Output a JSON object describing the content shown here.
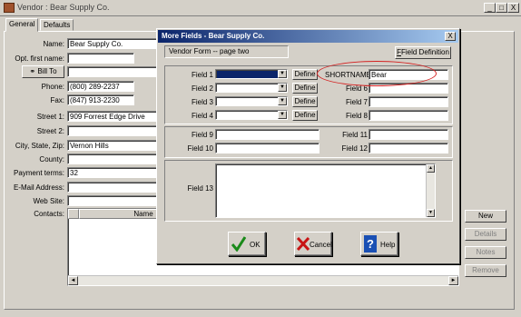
{
  "window": {
    "title": "Vendor : Bear Supply Co.",
    "controls": [
      "_",
      "□",
      "X"
    ]
  },
  "tabs": [
    {
      "label": "General"
    },
    {
      "label": "Defaults"
    }
  ],
  "form": {
    "name_label": "Name:",
    "name_value": "Bear Supply Co.",
    "opt_first_label": "Opt. first name:",
    "opt_first_value": "",
    "bill_to_label": "Bill To",
    "bill_to_value": "",
    "phone_label": "Phone:",
    "phone_value": "(800) 289-2237",
    "fax_label": "Fax:",
    "fax_value": "(847) 913-2230",
    "street1_label": "Street 1:",
    "street1_value": "909 Forrest Edge Drive",
    "street2_label": "Street 2:",
    "street2_value": "",
    "city_label": "City, State, Zip:",
    "city_value": "Vernon Hills",
    "county_label": "County:",
    "county_value": "",
    "payment_label": "Payment terms:",
    "payment_value": "32",
    "email_label": "E-Mail Address:",
    "email_value": "",
    "website_label": "Web Site:",
    "website_value": "",
    "contacts_label": "Contacts:",
    "contacts_column": "Name"
  },
  "side_buttons": {
    "new": "New",
    "details": "Details",
    "notes": "Notes",
    "remove": "Remove"
  },
  "dialog": {
    "title": "More Fields - Bear Supply Co.",
    "close": "X",
    "page_caption": "Vendor Form -- page two",
    "field_definition": "Field Definition",
    "define": "Define",
    "fields": {
      "f1": "Field 1",
      "f2": "Field 2",
      "f3": "Field 3",
      "f4": "Field 4",
      "f6": "Field 6",
      "f7": "Field 7",
      "f8": "Field 8",
      "f9": "Field 9",
      "f10": "Field 10",
      "f11": "Field 11",
      "f12": "Field 12",
      "f13": "Field 13"
    },
    "shortname_label": "SHORTNAME",
    "shortname_value": "Bear",
    "ok": "OK",
    "cancel": "Cancel",
    "help": "Help"
  },
  "colors": {
    "titlebar_start": "#0a246a",
    "titlebar_end": "#a6caf0",
    "annotation": "#d42020",
    "selected": "#0a246a"
  }
}
